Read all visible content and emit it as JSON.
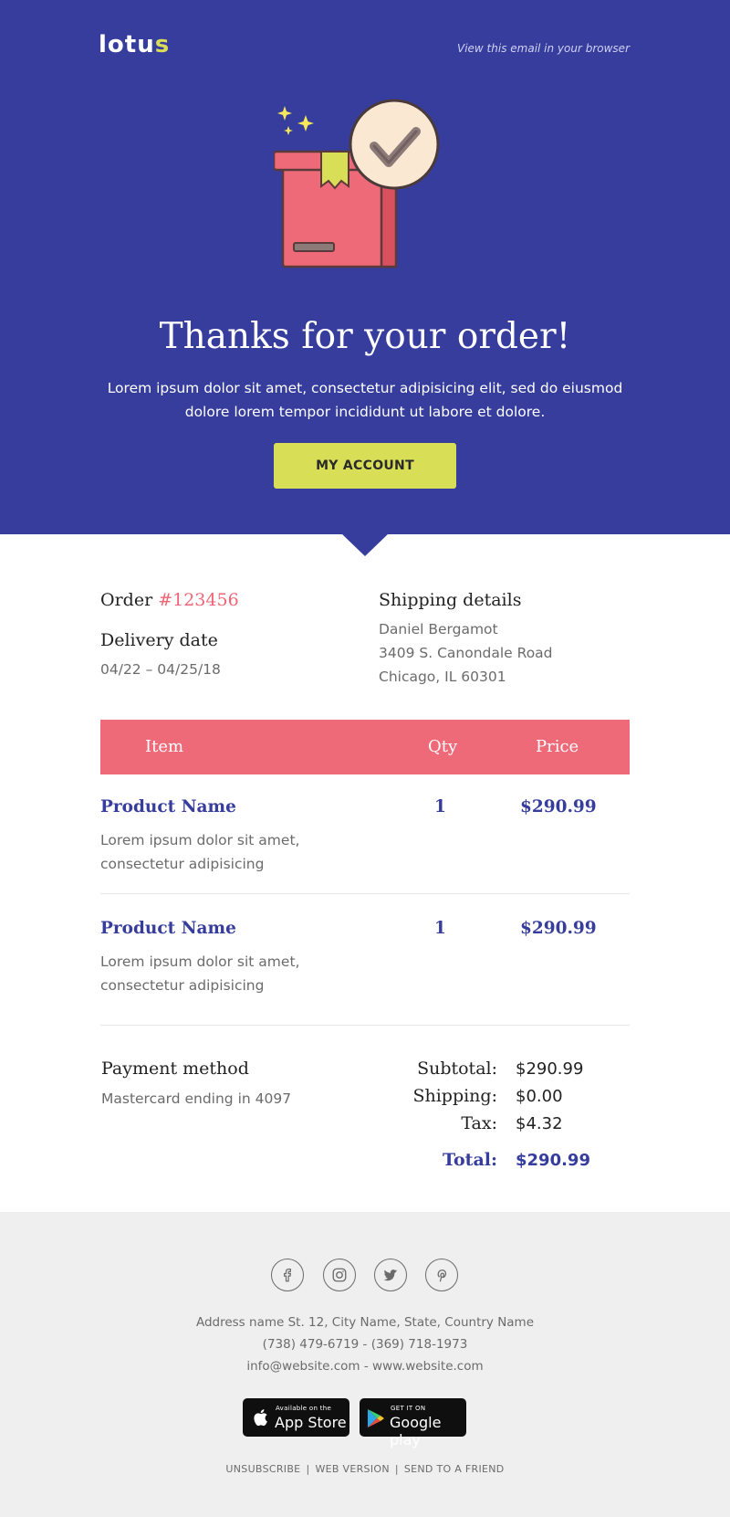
{
  "header": {
    "logo_main": "lotu",
    "logo_accent": "s",
    "view_in_browser": "View this email in your browser"
  },
  "hero": {
    "title": "Thanks for your order!",
    "subtitle": "Lorem ipsum dolor sit amet, consectetur adipisicing elit, sed do eiusmod dolore lorem tempor incididunt ut labore et dolore.",
    "button_label": "MY ACCOUNT",
    "illustration_icon": "delivered-box-check-icon"
  },
  "order": {
    "label": "Order",
    "number": "#123456",
    "delivery_label": "Delivery date",
    "delivery_range": "04/22 – 04/25/18"
  },
  "shipping": {
    "label": "Shipping details",
    "lines": [
      "Daniel Bergamot",
      "3409 S. Canondale Road",
      "Chicago, IL 60301"
    ]
  },
  "table": {
    "headers": [
      "Item",
      "Qty",
      "Price"
    ],
    "rows": [
      {
        "name": "Product Name",
        "desc": "Lorem ipsum dolor sit amet, consectetur adipisicing",
        "qty": "1",
        "price": "$290.99"
      },
      {
        "name": "Product Name",
        "desc": "Lorem ipsum dolor sit amet, consectetur adipisicing",
        "qty": "1",
        "price": "$290.99"
      }
    ]
  },
  "payment": {
    "label": "Payment method",
    "detail": "Mastercard ending in 4097"
  },
  "totals": {
    "subtotal_label": "Subtotal:",
    "subtotal": "$290.99",
    "shipping_label": "Shipping:",
    "shipping": "$0.00",
    "tax_label": "Tax:",
    "tax": "$4.32",
    "total_label": "Total:",
    "total": "$290.99"
  },
  "footer": {
    "social": [
      "facebook-icon",
      "instagram-icon",
      "twitter-icon",
      "pinterest-icon"
    ],
    "address": "Address name St. 12, City Name, State, Country Name",
    "phones": "(738) 479-6719 - (369) 718-1973",
    "contact": "info@website.com - www.website.com",
    "appstore_small": "Available on the",
    "appstore_big": "App Store",
    "googleplay_small": "GET IT ON",
    "googleplay_big": "Google play",
    "links": [
      "UNSUBSCRIBE",
      "WEB VERSION",
      "SEND TO A FRIEND"
    ]
  },
  "colors": {
    "hero_bg": "#363d9c",
    "accent_yellow": "#d8de56",
    "accent_pink": "#ef6a78",
    "footer_bg": "#efefef"
  }
}
